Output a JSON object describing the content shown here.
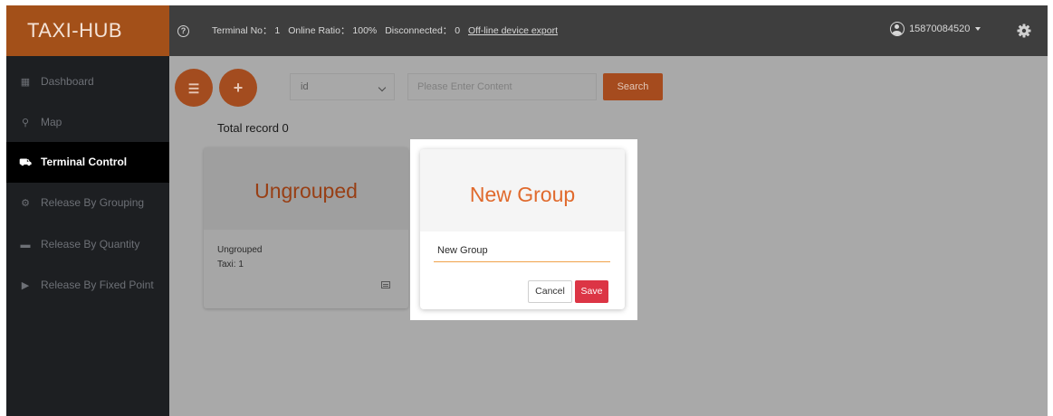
{
  "app": {
    "brand": "TAXI-HUB"
  },
  "header": {
    "terminal_no": "Terminal No： 1",
    "online_ratio": "Online Ratio： 100%",
    "disconnected": "Disconnected： 0",
    "export_link": "Off-line device export",
    "user_phone": "15870084520",
    "icons": [
      "help-icon",
      "avatar-icon",
      "chevron-down-icon",
      "gear-icon"
    ]
  },
  "sidebar": {
    "items": [
      {
        "label": "Dashboard",
        "icon": "dashboard-icon",
        "active": false
      },
      {
        "label": "Map",
        "icon": "map-icon",
        "active": false
      },
      {
        "label": "Terminal Control",
        "icon": "car-icon",
        "active": true
      },
      {
        "label": "Release By Grouping",
        "icon": "grouping-icon",
        "active": false
      },
      {
        "label": "Release By Quantity",
        "icon": "quantity-icon",
        "active": false
      },
      {
        "label": "Release By Fixed Point",
        "icon": "play-icon",
        "active": false
      }
    ]
  },
  "toolbar": {
    "select_value": "id",
    "search_placeholder": "Please Enter Content",
    "search_button": "Search",
    "icons": [
      "list-icon",
      "plus-icon"
    ]
  },
  "content": {
    "total_record": "Total record  0",
    "groups": [
      {
        "title": "Ungrouped",
        "name": "Ungrouped",
        "count": "Taxi: 1"
      }
    ]
  },
  "dialog": {
    "title": "New Group",
    "input_value": "New Group",
    "cancel_label": "Cancel",
    "save_label": "Save"
  },
  "colors": {
    "brand": "#e06a2d",
    "topbar": "#3e3e3e",
    "sidebar": "#1d1f22",
    "save": "#dc3545",
    "overlay": "#a9a9a9"
  }
}
